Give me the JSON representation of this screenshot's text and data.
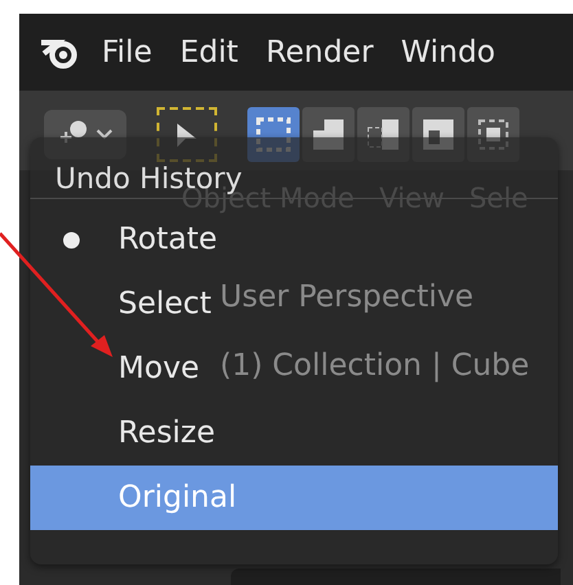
{
  "menubar": {
    "items": [
      "File",
      "Edit",
      "Render",
      "Windo"
    ]
  },
  "viewport": {
    "header": [
      "Object Mode",
      "View",
      "Sele"
    ],
    "overlay": [
      "User Perspective",
      "(1) Collection | Cube"
    ]
  },
  "undo_history": {
    "title": "Undo History",
    "items": [
      {
        "label": "Rotate",
        "current": true,
        "selected": false
      },
      {
        "label": "Select",
        "current": false,
        "selected": false
      },
      {
        "label": "Move",
        "current": false,
        "selected": false
      },
      {
        "label": "Resize",
        "current": false,
        "selected": false
      },
      {
        "label": "Original",
        "current": false,
        "selected": true
      }
    ]
  }
}
